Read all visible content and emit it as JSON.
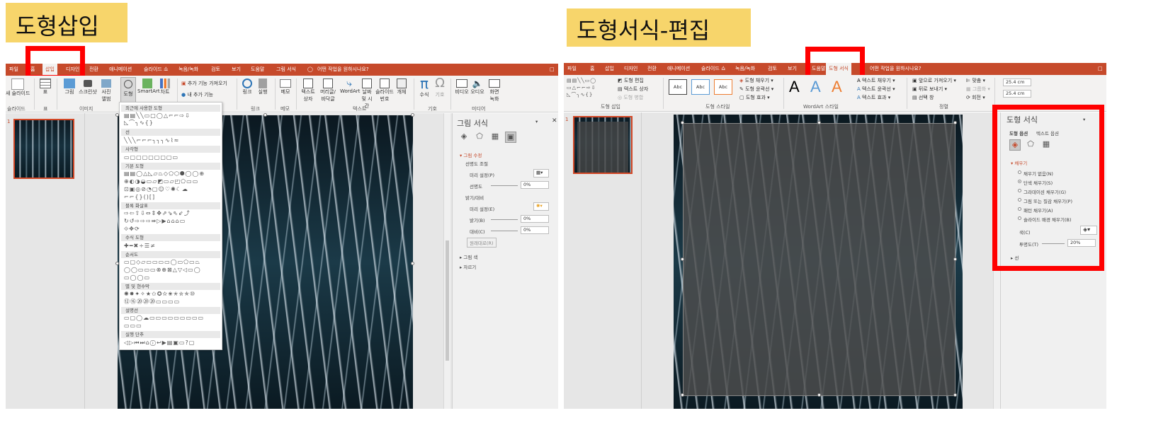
{
  "left": {
    "title": "도형삽입",
    "tabs": [
      "파일",
      "홈",
      "삽입",
      "디자인",
      "전환",
      "애니메이션",
      "슬라이드 쇼",
      "녹음/녹화",
      "검토",
      "보기",
      "도움말",
      "그림 서식"
    ],
    "tell_me": "어떤 작업을 원하시나요?",
    "ribbon": {
      "new_slide": "새 슬라이드",
      "table": "표",
      "picture": "그림",
      "screenshot": "스크린샷",
      "album": "사진 앨범",
      "shapes": "도형",
      "smartart": "SmartArt",
      "chart": "차트",
      "addins1": "추가 기능 가져오기",
      "addins2": "내 추가 기능",
      "link": "링크",
      "action": "실행",
      "comment": "메모",
      "textbox": "텍스트 상자",
      "header": "머리글/ 바닥글",
      "wordart": "WordArt",
      "datetime": "날짜 및 시간",
      "slidenum": "슬라이드 번호",
      "object": "개체",
      "equation": "수식",
      "symbol": "기호",
      "video": "비디오",
      "audio": "오디오",
      "screenrec": "화면 녹화"
    },
    "groups": [
      "슬라이드",
      "표",
      "이미지",
      "링크",
      "메모",
      "텍스트",
      "기호",
      "미디어"
    ],
    "slide_num": "1",
    "shape_menu": {
      "recent": "최근에 사용한 도형",
      "line": "선",
      "rect": "사각형",
      "basic": "기본 도형",
      "block_arrows": "블록 화살표",
      "equation": "수식 도형",
      "flowchart": "순서도",
      "stars": "별 및 현수막",
      "callouts": "설명선",
      "action_buttons": "실행 단추"
    },
    "pane": {
      "title": "그림 서식",
      "section_correction": "그림 수정",
      "sharpen_label": "선명도 조절",
      "preset1": "미리 설정(P)",
      "sharpness": "선명도",
      "sharpness_val": "0%",
      "brightness_label": "밝기/대비",
      "preset2": "미리 설정(E)",
      "brightness": "밝기(B)",
      "brightness_val": "0%",
      "contrast": "대비(C)",
      "contrast_val": "0%",
      "reset": "원래대로(R)",
      "color": "그림 색",
      "crop": "자르기"
    }
  },
  "right": {
    "title": "도형서식-편집",
    "tabs": [
      "파일",
      "홈",
      "삽입",
      "디자인",
      "전환",
      "애니메이션",
      "슬라이드 쇼",
      "녹음/녹화",
      "검토",
      "보기",
      "도움말",
      "도형 서식"
    ],
    "tell_me": "어떤 작업을 원하시나요?",
    "ribbon": {
      "edit_shape": "도형 편집",
      "textbox": "텍스트 상자",
      "merge": "도형 병합",
      "style_sample": "Abc",
      "fill": "도형 채우기",
      "outline": "도형 윤곽선",
      "effect": "도형 효과",
      "text_fill": "텍스트 채우기",
      "text_outline": "텍스트 윤곽선",
      "text_effect": "텍스트 효과",
      "bring_forward": "앞으로 가져오기",
      "send_backward": "뒤로 보내기",
      "selection": "선택 창",
      "align": "맞춤",
      "group": "그룹화",
      "rotate": "회전",
      "height": "25.4 cm",
      "width": "25.4 cm",
      "wordart_letter": "A"
    },
    "groups": [
      "도형 삽입",
      "도형 스타일",
      "WordArt 스타일",
      "정렬"
    ],
    "slide_num": "1",
    "pane": {
      "title": "도형 서식",
      "tab_shape": "도형 옵션",
      "tab_text": "텍스트 옵션",
      "section_fill": "채우기",
      "opt1": "채우기 없음(N)",
      "opt2": "단색 채우기(S)",
      "opt3": "그라데이션 채우기(G)",
      "opt4": "그림 또는 질감 채우기(P)",
      "opt5": "패턴 채우기(A)",
      "opt6": "슬라이드 배경 채우기(B)",
      "color": "색(C)",
      "transparency": "투명도(T)",
      "transparency_val": "20%",
      "line": "선"
    }
  }
}
